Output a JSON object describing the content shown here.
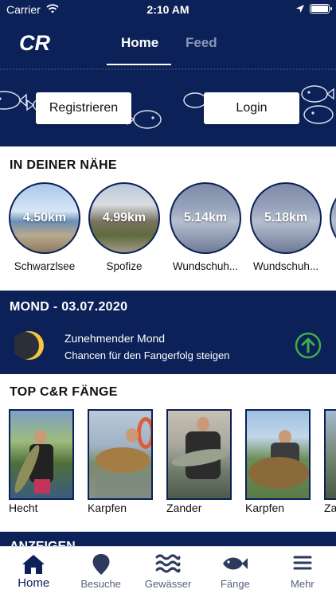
{
  "status_bar": {
    "carrier": "Carrier",
    "time": "2:10 AM"
  },
  "header": {
    "logo": "CR",
    "tabs": [
      {
        "label": "Home",
        "active": true
      },
      {
        "label": "Feed",
        "active": false
      }
    ]
  },
  "banner": {
    "register_label": "Registrieren",
    "login_label": "Login"
  },
  "nearby": {
    "title": "IN DEINER NÄHE",
    "spots": [
      {
        "distance": "4.50km",
        "name": "Schwarzlsee"
      },
      {
        "distance": "4.99km",
        "name": "Spofize"
      },
      {
        "distance": "5.14km",
        "name": "Wundschuh..."
      },
      {
        "distance": "5.18km",
        "name": "Wundschuh..."
      }
    ]
  },
  "moon": {
    "title": "MOND - 03.07.2020",
    "phase": "Zunehmender Mond",
    "chance": "Chancen für den Fangerfolg steigen",
    "trend_icon": "arrow-up-circle-icon",
    "trend_color": "#3fae49"
  },
  "catches": {
    "title": "TOP C&R FÄNGE",
    "items": [
      {
        "species": "Hecht"
      },
      {
        "species": "Karpfen"
      },
      {
        "species": "Zander"
      },
      {
        "species": "Karpfen"
      },
      {
        "species": "Za"
      }
    ]
  },
  "ads": {
    "title": "ANZEIGEN"
  },
  "tab_bar": {
    "items": [
      {
        "label": "Home",
        "icon": "home-icon",
        "active": true
      },
      {
        "label": "Besuche",
        "icon": "map-pin-icon",
        "active": false
      },
      {
        "label": "Gewässer",
        "icon": "waves-icon",
        "active": false
      },
      {
        "label": "Fänge",
        "icon": "fish-icon",
        "active": false
      },
      {
        "label": "Mehr",
        "icon": "menu-icon",
        "active": false
      }
    ]
  },
  "colors": {
    "navy": "#0c2157",
    "white": "#ffffff",
    "inactive_tab": "#8b97b6"
  }
}
